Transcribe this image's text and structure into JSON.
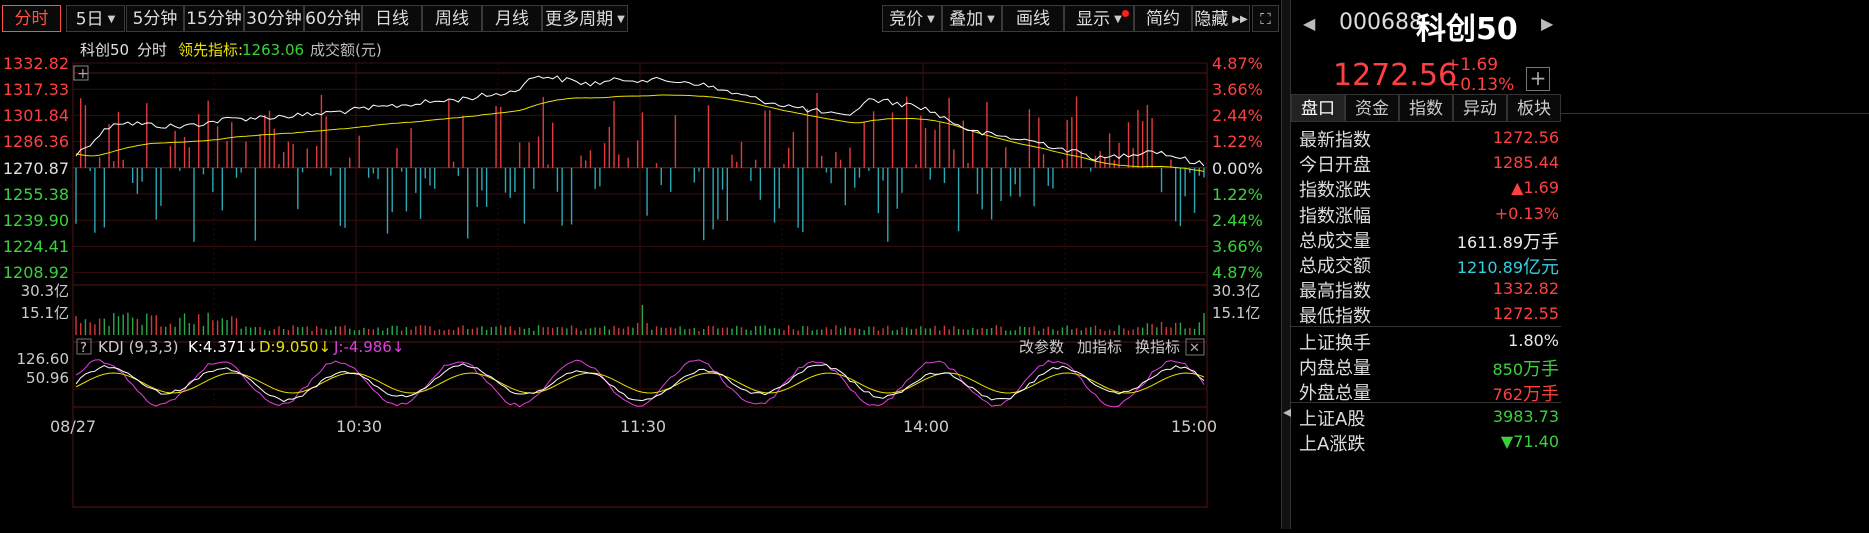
{
  "toolbar": {
    "tabs": [
      "分时",
      "5日",
      "5分钟",
      "15分钟",
      "30分钟",
      "60分钟",
      "日线",
      "周线",
      "月线",
      "更多周期"
    ],
    "right_buttons": [
      "竞价",
      "叠加",
      "画线",
      "显示",
      "简约",
      "隐藏"
    ]
  },
  "chart_header": {
    "name": "科创50",
    "mode": "分时",
    "leading_label": "领先指标:",
    "leading_value": "1263.06",
    "volume_label": "成交额(元)"
  },
  "price_axis_left": [
    "1332.82",
    "1317.33",
    "1301.84",
    "1286.36",
    "1270.87",
    "1255.38",
    "1239.90",
    "1224.41",
    "1208.92"
  ],
  "pct_axis_right": [
    "4.87%",
    "3.66%",
    "2.44%",
    "1.22%",
    "0.00%",
    "1.22%",
    "2.44%",
    "3.66%",
    "4.87%"
  ],
  "volume_axis": {
    "top_left": "30.3亿",
    "mid_left": "15.1亿",
    "top_right": "30.3亿",
    "mid_right": "15.1亿"
  },
  "kdj": {
    "help": "?",
    "title": "KDJ (9,3,3)",
    "k": "K:4.371↓",
    "d": "D:9.050↓",
    "j": "J:-4.986↓",
    "axis": [
      "126.60",
      "50.96"
    ],
    "actions": [
      "改参数",
      "加指标",
      "换指标"
    ],
    "close": "✕"
  },
  "time_axis": [
    "08/27",
    "10:30",
    "11:30",
    "14:00",
    "15:00"
  ],
  "quote": {
    "code": "000688",
    "name": "科创50",
    "price": "1272.56",
    "change": "+1.69",
    "change_pct": "+0.13%",
    "add_icon": "+"
  },
  "quote_tabs": [
    "盘口",
    "资金",
    "指数",
    "异动",
    "板块"
  ],
  "quote_rows": [
    {
      "k": "最新指数",
      "v": "1272.56",
      "u": "",
      "color": "red"
    },
    {
      "k": "今日开盘",
      "v": "1285.44",
      "u": "",
      "color": "red"
    },
    {
      "k": "指数涨跌",
      "v": "▲1.69",
      "u": "",
      "color": "red"
    },
    {
      "k": "指数涨幅",
      "v": "+0.13%",
      "u": "",
      "color": "red"
    },
    {
      "k": "总成交量",
      "v": "1611.89",
      "u": "万手",
      "color": "white"
    },
    {
      "k": "总成交额",
      "v": "1210.89",
      "u": "亿元",
      "color": "cyan"
    },
    {
      "k": "最高指数",
      "v": "1332.82",
      "u": "",
      "color": "red"
    },
    {
      "k": "最低指数",
      "v": "1272.55",
      "u": "",
      "color": "red"
    }
  ],
  "quote_rows2": [
    {
      "k": "上证换手",
      "v": "1.80%",
      "u": "",
      "color": "white"
    },
    {
      "k": "内盘总量",
      "v": "850",
      "u": "万手",
      "color": "green"
    },
    {
      "k": "外盘总量",
      "v": "762",
      "u": "万手",
      "color": "red"
    }
  ],
  "quote_rows3": [
    {
      "k": "上证A股",
      "v": "3983.73",
      "u": "",
      "color": "green"
    },
    {
      "k": "上A涨跌",
      "v": "▼71.40",
      "u": "",
      "color": "green"
    }
  ],
  "colors": {
    "up": "#ff4040",
    "down": "#35c0c8",
    "price_line": "#ffffff",
    "avg_line": "#e8e000",
    "grid": "#3a1010"
  }
}
